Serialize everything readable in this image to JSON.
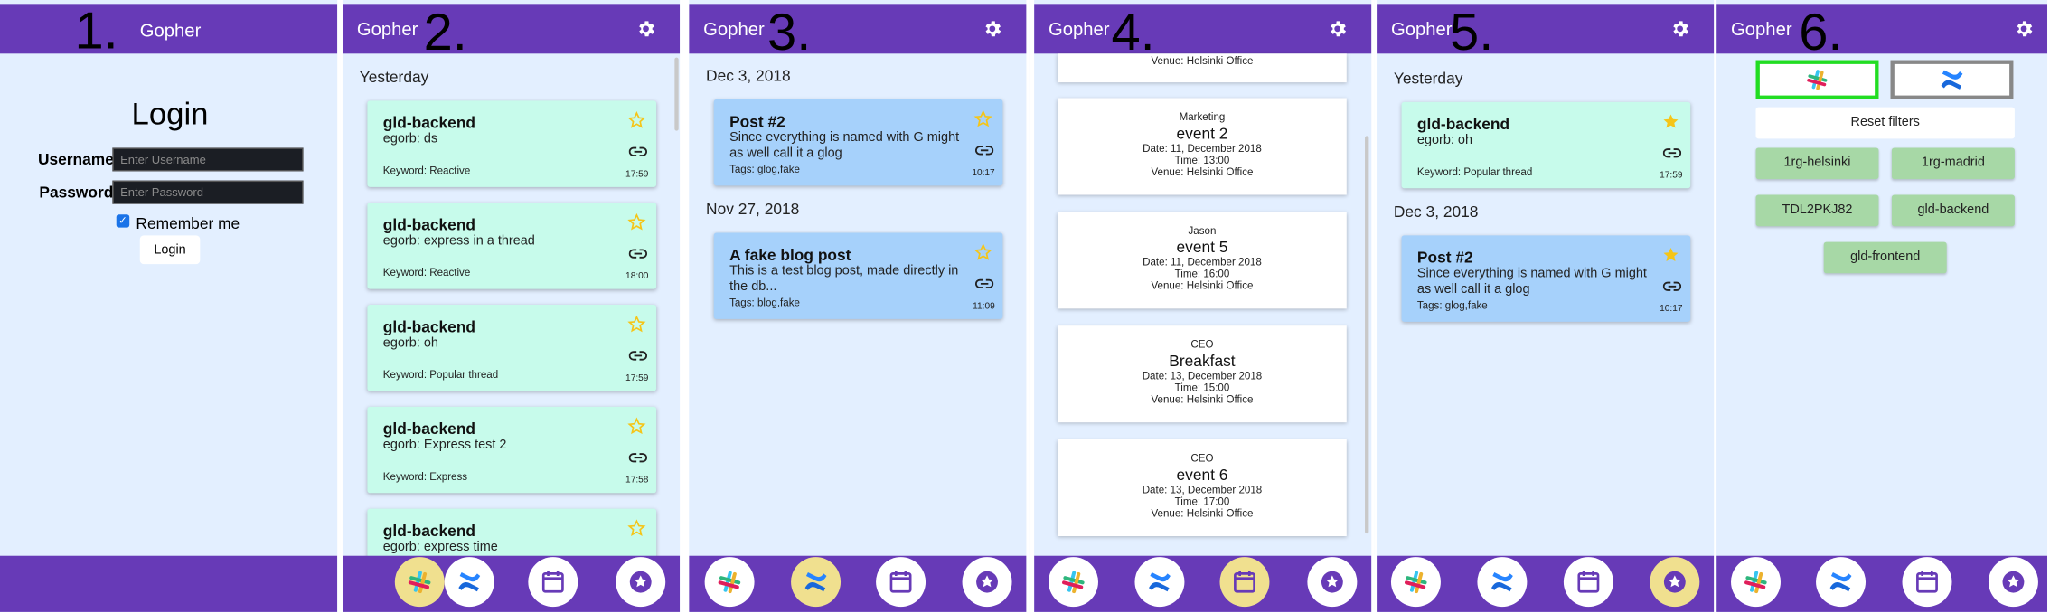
{
  "app_title": "Gopher",
  "panel_numbers": [
    "1.",
    "2.",
    "3.",
    "4.",
    "5.",
    "6."
  ],
  "colors": {
    "header": "#673ab7",
    "background": "#e3efff",
    "message_card": "#c7fbeb",
    "blog_card": "#a6d1fb",
    "nav_active": "#f0e08f",
    "filter_chip": "#a7d8a6"
  },
  "nav_icons": [
    "slack-icon",
    "confluence-icon",
    "calendar-icon",
    "starred-icon"
  ],
  "login": {
    "title": "Login",
    "username_label": "Username",
    "username_placeholder": "Enter Username",
    "password_label": "Password",
    "password_placeholder": "Enter Password",
    "remember_label": "Remember me",
    "remember_checked": true,
    "button": "Login"
  },
  "messages": {
    "date": "Yesterday",
    "items": [
      {
        "title": "gld-backend",
        "snippet": "egorb: ds",
        "keyword": "Keyword: Reactive",
        "time": "17:59"
      },
      {
        "title": "gld-backend",
        "snippet": "egorb: express in a thread",
        "keyword": "Keyword: Reactive",
        "time": "18:00"
      },
      {
        "title": "gld-backend",
        "snippet": "egorb: oh",
        "keyword": "Keyword: Popular thread",
        "time": "17:59"
      },
      {
        "title": "gld-backend",
        "snippet": "egorb: Express test 2",
        "keyword": "Keyword: Express",
        "time": "17:58"
      },
      {
        "title": "gld-backend",
        "snippet": "egorb: express time",
        "keyword": "",
        "time": ""
      }
    ]
  },
  "blog": {
    "groups": [
      {
        "date": "Dec 3, 2018",
        "title": "Post #2",
        "snippet": "Since everything is named with G might as well call it a glog",
        "tags": "Tags: glog,fake",
        "time": "10:17"
      },
      {
        "date": "Nov 27, 2018",
        "title": "A fake blog post",
        "snippet": "This is a test blog post, made directly in the db...",
        "tags": "Tags: blog,fake",
        "time": "11:09"
      }
    ]
  },
  "events": {
    "partial_venue": "Venue: Helsinki Office",
    "items": [
      {
        "organizer": "Marketing",
        "name": "event 2",
        "date": "Date: 11, December 2018",
        "time": "Time: 13:00",
        "venue": "Venue: Helsinki Office"
      },
      {
        "organizer": "Jason",
        "name": "event 5",
        "date": "Date: 11, December 2018",
        "time": "Time: 16:00",
        "venue": "Venue: Helsinki Office"
      },
      {
        "organizer": "CEO",
        "name": "Breakfast",
        "date": "Date: 13, December 2018",
        "time": "Time: 15:00",
        "venue": "Venue: Helsinki Office"
      },
      {
        "organizer": "CEO",
        "name": "event 6",
        "date": "Date: 13, December 2018",
        "time": "Time: 17:00",
        "venue": "Venue: Helsinki Office"
      }
    ]
  },
  "starred": {
    "groups": [
      {
        "date": "Yesterday",
        "title": "gld-backend",
        "snippet": "egorb: oh",
        "keyword": "Keyword: Popular thread",
        "time": "17:59",
        "kind": "message"
      },
      {
        "date": "Dec 3, 2018",
        "title": "Post #2",
        "snippet": "Since everything is named with G might as well call it a glog",
        "keyword": "Tags: glog,fake",
        "time": "10:17",
        "kind": "blog"
      }
    ]
  },
  "filters": {
    "reset_label": "Reset filters",
    "sources": [
      {
        "name": "slack-icon",
        "border": "#22dd22"
      },
      {
        "name": "confluence-icon",
        "border": "#888888"
      }
    ],
    "channels": [
      "1rg-helsinki",
      "1rg-madrid",
      "TDL2PKJ82",
      "gld-backend",
      "gld-frontend"
    ]
  }
}
